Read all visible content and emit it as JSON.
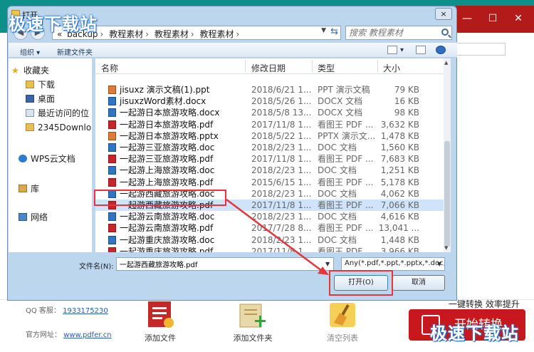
{
  "dialog": {
    "title": "打开",
    "close_glyph": "×",
    "breadcrumb": [
      "«",
      "backup",
      "教程素材",
      "教程素材",
      "教程素材"
    ],
    "search_placeholder": "搜索 教程素材",
    "toolbar": {
      "organize": "组织 ▾",
      "new_folder": "新建文件夹"
    },
    "nav_pane": [
      {
        "label": "收藏夹",
        "icon": "star-icon"
      },
      {
        "label": "下载",
        "icon": "folder-icon"
      },
      {
        "label": "桌面",
        "icon": "desktop-icon"
      },
      {
        "label": "最近访问的位",
        "icon": "recent-places-icon"
      },
      {
        "label": "2345Downlo",
        "icon": "folder-icon"
      },
      {
        "label": "WPS云文档",
        "icon": "cloud-icon"
      },
      {
        "label": "库",
        "icon": "library-icon"
      },
      {
        "label": "网络",
        "icon": "network-icon"
      }
    ],
    "columns": {
      "name": "名称",
      "date": "修改日期",
      "type": "类型",
      "size": "大小"
    },
    "files": [
      {
        "name": "jisuxz 演示文稿(1).ppt",
        "date": "2018/6/21 1...",
        "type": "PPT 演示文稿",
        "size": "79 KB",
        "kind": "ppt"
      },
      {
        "name": "jisuxzWord素材.docx",
        "date": "2018/5/26 1...",
        "type": "DOCX 文档",
        "size": "16 KB",
        "kind": "doc"
      },
      {
        "name": "一起游日本旅游攻略.docx",
        "date": "2018/5/8 13...",
        "type": "DOCX 文档",
        "size": "98 KB",
        "kind": "doc"
      },
      {
        "name": "一起游日本旅游攻略.pdf",
        "date": "2017/11/8 1...",
        "type": "看图王 PDF ...",
        "size": "3,632 KB",
        "kind": "pdf"
      },
      {
        "name": "一起游日本旅游攻略.pptx",
        "date": "2018/5/22 1...",
        "type": "PPTX 演示文...",
        "size": "1,478 KB",
        "kind": "ppt"
      },
      {
        "name": "一起游三亚旅游攻略.doc",
        "date": "2018/2/23 1...",
        "type": "DOC 文档",
        "size": "1,560 KB",
        "kind": "doc"
      },
      {
        "name": "一起游三亚旅游攻略.pdf",
        "date": "2017/11/8 1...",
        "type": "看图王 PDF ...",
        "size": "7,683 KB",
        "kind": "pdf"
      },
      {
        "name": "一起游上海旅游攻略.doc",
        "date": "2018/2/23 1...",
        "type": "DOC 文档",
        "size": "1,251 KB",
        "kind": "doc"
      },
      {
        "name": "一起游上海旅游攻略.pdf",
        "date": "2015/6/15 1...",
        "type": "看图王 PDF ...",
        "size": "5,178 KB",
        "kind": "pdf"
      },
      {
        "name": "一起游西藏旅游攻略.doc",
        "date": "2018/2/23 1...",
        "type": "DOC 文档",
        "size": "4,062 KB",
        "kind": "doc"
      },
      {
        "name": "一起游西藏旅游攻略.pdf",
        "date": "2017/11/8 1...",
        "type": "看图王 PDF ...",
        "size": "7,066 KB",
        "kind": "pdf",
        "selected": true
      },
      {
        "name": "一起游云南旅游攻略.doc",
        "date": "2018/2/23 1...",
        "type": "DOC 文档",
        "size": "4,616 KB",
        "kind": "doc"
      },
      {
        "name": "一起游云南旅游攻略.pdf",
        "date": "2017/7/28 8...",
        "type": "看图王 PDF ...",
        "size": "13,041 ...",
        "kind": "pdf"
      },
      {
        "name": "一起游重庆旅游攻略.doc",
        "date": "2018/2/23 1...",
        "type": "DOC 文档",
        "size": "1,448 KB",
        "kind": "doc"
      },
      {
        "name": "一起游重庆旅游攻略.pdf",
        "date": "2017/11/8 1...",
        "type": "看图王 PDF ...",
        "size": "3,966 KB",
        "kind": "pdf"
      }
    ],
    "filename_label": "文件名(N):",
    "filename_value": "一起游西藏旅游攻略.pdf",
    "filetype_value": "Any(*.pdf,*.ppt,*.pptx,*.doc,*.",
    "open_label": "打开(O)",
    "cancel_label": "取消"
  },
  "app": {
    "qq_label": "QQ 客服：",
    "qq_value": "1933175230",
    "site_label": "官方网址：",
    "site_value": "www.pdfer.cn",
    "tools": [
      {
        "label": "添加文件"
      },
      {
        "label": "添加文件夹"
      },
      {
        "label": "清空列表"
      }
    ],
    "slogan": "一键转换  效率提升",
    "convert_label": "开始转换",
    "min_glyph": "—",
    "max_glyph": "☐",
    "close_glyph": "✕"
  },
  "watermarks": [
    "极速下载站",
    "极速下载站"
  ],
  "colors": {
    "highlight": "#e5363d",
    "app_accent": "#c8171d"
  }
}
